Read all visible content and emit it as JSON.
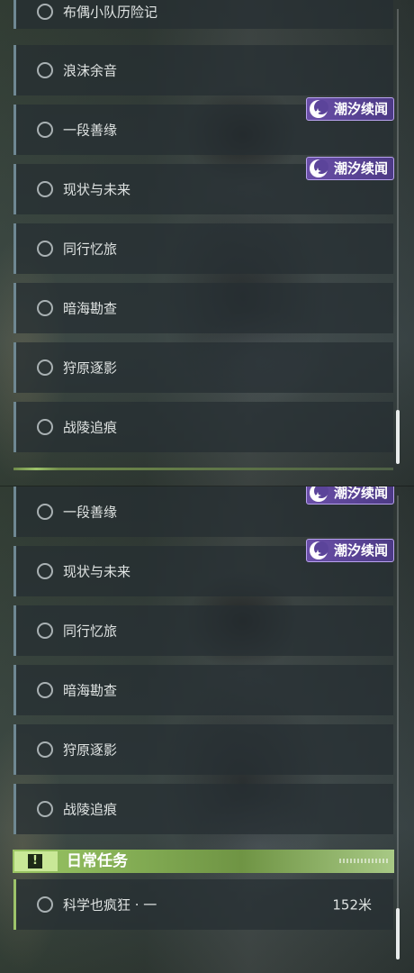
{
  "top": {
    "quests": [
      {
        "label": "布偶小队历险记"
      },
      {
        "label": "浪沫余音"
      },
      {
        "label": "一段善缘",
        "badge": "潮汐续闻"
      },
      {
        "label": "现状与未来",
        "badge": "潮汐续闻"
      },
      {
        "label": "同行忆旅"
      },
      {
        "label": "暗海勘查"
      },
      {
        "label": "狩原逐影"
      },
      {
        "label": "战陵追痕"
      }
    ]
  },
  "bottom": {
    "quests": [
      {
        "label": "一段善缘",
        "badge": "潮汐续闻"
      },
      {
        "label": "现状与未来",
        "badge": "潮汐续闻"
      },
      {
        "label": "同行忆旅"
      },
      {
        "label": "暗海勘查"
      },
      {
        "label": "狩原逐影"
      },
      {
        "label": "战陵追痕"
      }
    ],
    "daily_section": {
      "title": "日常任务",
      "icon": "alert-icon",
      "quests": [
        {
          "label": "科学也疯狂 · 一",
          "distance": "152米"
        }
      ]
    }
  },
  "colors": {
    "badge_bg": "#5b449a",
    "daily_accent": "#9dc36a",
    "row_accent": "#6f8893"
  }
}
